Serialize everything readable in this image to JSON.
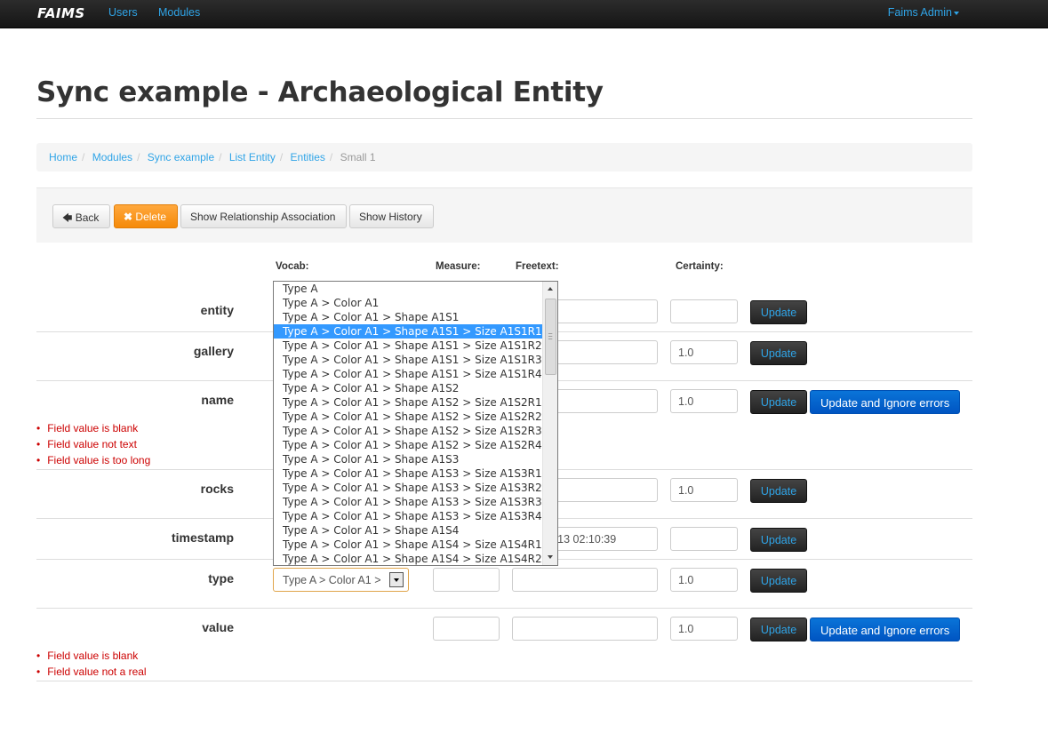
{
  "navbar": {
    "brand": "FAIMS",
    "links": [
      "Users",
      "Modules"
    ],
    "user": "Faims Admin"
  },
  "page": {
    "title": "Sync example - Archaeological Entity"
  },
  "breadcrumb": {
    "items": [
      "Home",
      "Modules",
      "Sync example",
      "List Entity",
      "Entities"
    ],
    "active": "Small 1"
  },
  "toolbar": {
    "back": "Back",
    "delete": "Delete",
    "show_relationship": "Show Relationship Association",
    "show_history": "Show History"
  },
  "columns": {
    "vocab": "Vocab:",
    "measure": "Measure:",
    "freetext": "Freetext:",
    "certainty": "Certainty:"
  },
  "buttons": {
    "update": "Update",
    "update_ignore": "Update and Ignore errors"
  },
  "rows": [
    {
      "label": "entity",
      "certainty": ""
    },
    {
      "label": "gallery",
      "certainty": "1.0"
    },
    {
      "label": "name",
      "certainty": "1.0",
      "errors": [
        "Field value is blank",
        "Field value not text",
        "Field value is too long"
      ]
    },
    {
      "label": "rocks",
      "certainty": "1.0"
    },
    {
      "label": "timestamp",
      "freetext": "-13 02:10:39",
      "certainty": ""
    },
    {
      "label": "type",
      "vocab_selected": "Type A > Color A1 > Shape A1S1 > Size A1S1R1",
      "vocab_visible": "Type A > Color A1 >",
      "measure": "",
      "freetext": "",
      "certainty": "1.0"
    },
    {
      "label": "value",
      "measure": "",
      "freetext": "",
      "certainty": "1.0",
      "errors": [
        "Field value is blank",
        "Field value not a real"
      ]
    }
  ],
  "dropdown": {
    "selected_index": 3,
    "options": [
      "Type A",
      "Type A > Color A1",
      "Type A > Color A1 > Shape A1S1",
      "Type A > Color A1 > Shape A1S1 > Size A1S1R1",
      "Type A > Color A1 > Shape A1S1 > Size A1S1R2",
      "Type A > Color A1 > Shape A1S1 > Size A1S1R3",
      "Type A > Color A1 > Shape A1S1 > Size A1S1R4",
      "Type A > Color A1 > Shape A1S2",
      "Type A > Color A1 > Shape A1S2 > Size A1S2R1",
      "Type A > Color A1 > Shape A1S2 > Size A1S2R2",
      "Type A > Color A1 > Shape A1S2 > Size A1S2R3",
      "Type A > Color A1 > Shape A1S2 > Size A1S2R4",
      "Type A > Color A1 > Shape A1S3",
      "Type A > Color A1 > Shape A1S3 > Size A1S3R1",
      "Type A > Color A1 > Shape A1S3 > Size A1S3R2",
      "Type A > Color A1 > Shape A1S3 > Size A1S3R3",
      "Type A > Color A1 > Shape A1S3 > Size A1S3R4",
      "Type A > Color A1 > Shape A1S4",
      "Type A > Color A1 > Shape A1S4 > Size A1S4R1",
      "Type A > Color A1 > Shape A1S4 > Size A1S4R2"
    ]
  },
  "icons": {
    "back": "arrow-left-icon",
    "delete": "close-icon"
  },
  "colors": {
    "accent": "#2fa4e7",
    "delete": "#f58a09",
    "error": "#cc0000",
    "primary": "#0062cc"
  }
}
